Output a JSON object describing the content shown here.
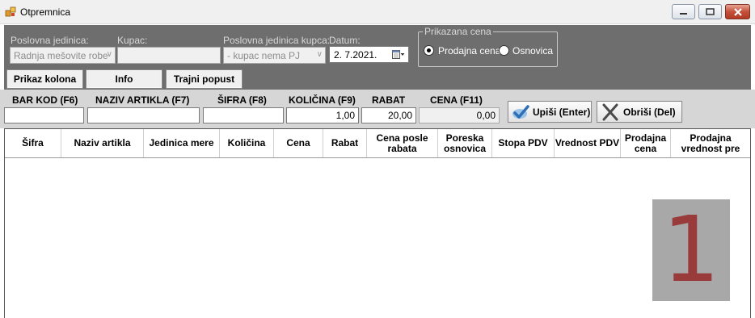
{
  "window": {
    "title": "Otpremnica"
  },
  "filters": {
    "poslovna_jedinica_label": "Poslovna jedinica:",
    "poslovna_jedinica_value": "Radnja mešovite robe",
    "kupac_label": "Kupac:",
    "kupac_value": "",
    "pj_kupca_label": "Poslovna jedinica kupca:",
    "pj_kupca_value": "- kupac nema PJ",
    "datum_label": "Datum:",
    "datum_value": "2.  7.2021.",
    "prikazana_cena_label": "Prikazana cena",
    "prodajna_cena_label": "Prodajna cena",
    "osnovica_label": "Osnovica"
  },
  "buttons": {
    "prikaz_kolona": "Prikaz kolona",
    "info": "Info",
    "trajni_popust": "Trajni popust",
    "upisi": "Upiši (Enter)",
    "obrisi": "Obriši (Del)"
  },
  "entry": {
    "bar_kod_label": "BAR KOD (F6)",
    "naziv_label": "NAZIV ARTIKLA (F7)",
    "sifra_label": "ŠIFRA (F8)",
    "kolicina_label": "KOLIČINA (F9)",
    "rabat_label": "RABAT",
    "cena_label": "CENA (F11)",
    "bar_kod_value": "",
    "naziv_value": "",
    "sifra_value": "",
    "kolicina_value": "1,00",
    "rabat_value": "20,00",
    "cena_value": "0,00"
  },
  "grid": {
    "columns": [
      "Šifra",
      "Naziv artikla",
      "Jedinica mere",
      "Količina",
      "Cena",
      "Rabat",
      "Cena posle rabata",
      "Poreska osnovica",
      "Stopa PDV",
      "Vrednost PDV",
      "Prodajna cena",
      "Prodajna vrednost pre"
    ],
    "rows": []
  },
  "badge": {
    "text": "1"
  },
  "colors": {
    "panel": "#6e6e6e",
    "entry_bar": "#d6d6d6",
    "badge_bg": "#a8a8a8",
    "badge_fg": "#9a3b3b"
  }
}
